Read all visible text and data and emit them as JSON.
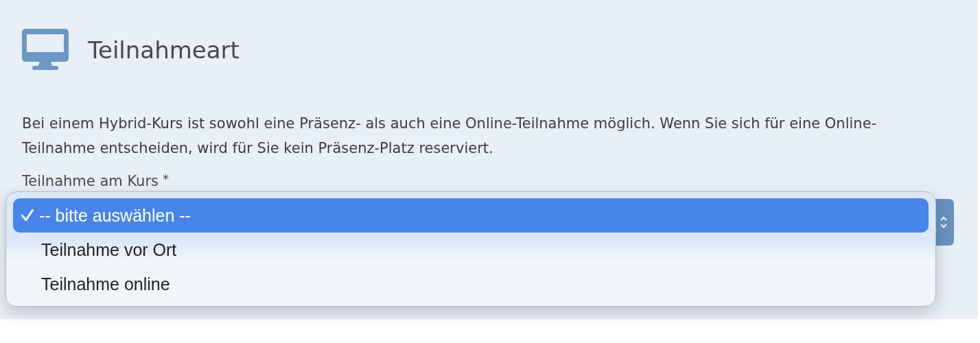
{
  "section": {
    "title": "Teilnahmeart"
  },
  "description": "Bei einem Hybrid-Kurs ist sowohl eine Präsenz- als auch eine Online-Teilnahme möglich. Wenn Sie sich für eine Online-Teilnahme entscheiden, wird für Sie kein Präsenz-Platz reserviert.",
  "field": {
    "label": "Teilnahme am Kurs",
    "required_mark": "*",
    "expanded": true
  },
  "options": [
    {
      "label": "-- bitte auswählen --",
      "selected": true
    },
    {
      "label": "Teilnahme vor Ort",
      "selected": false
    },
    {
      "label": "Teilnahme online",
      "selected": false
    }
  ]
}
